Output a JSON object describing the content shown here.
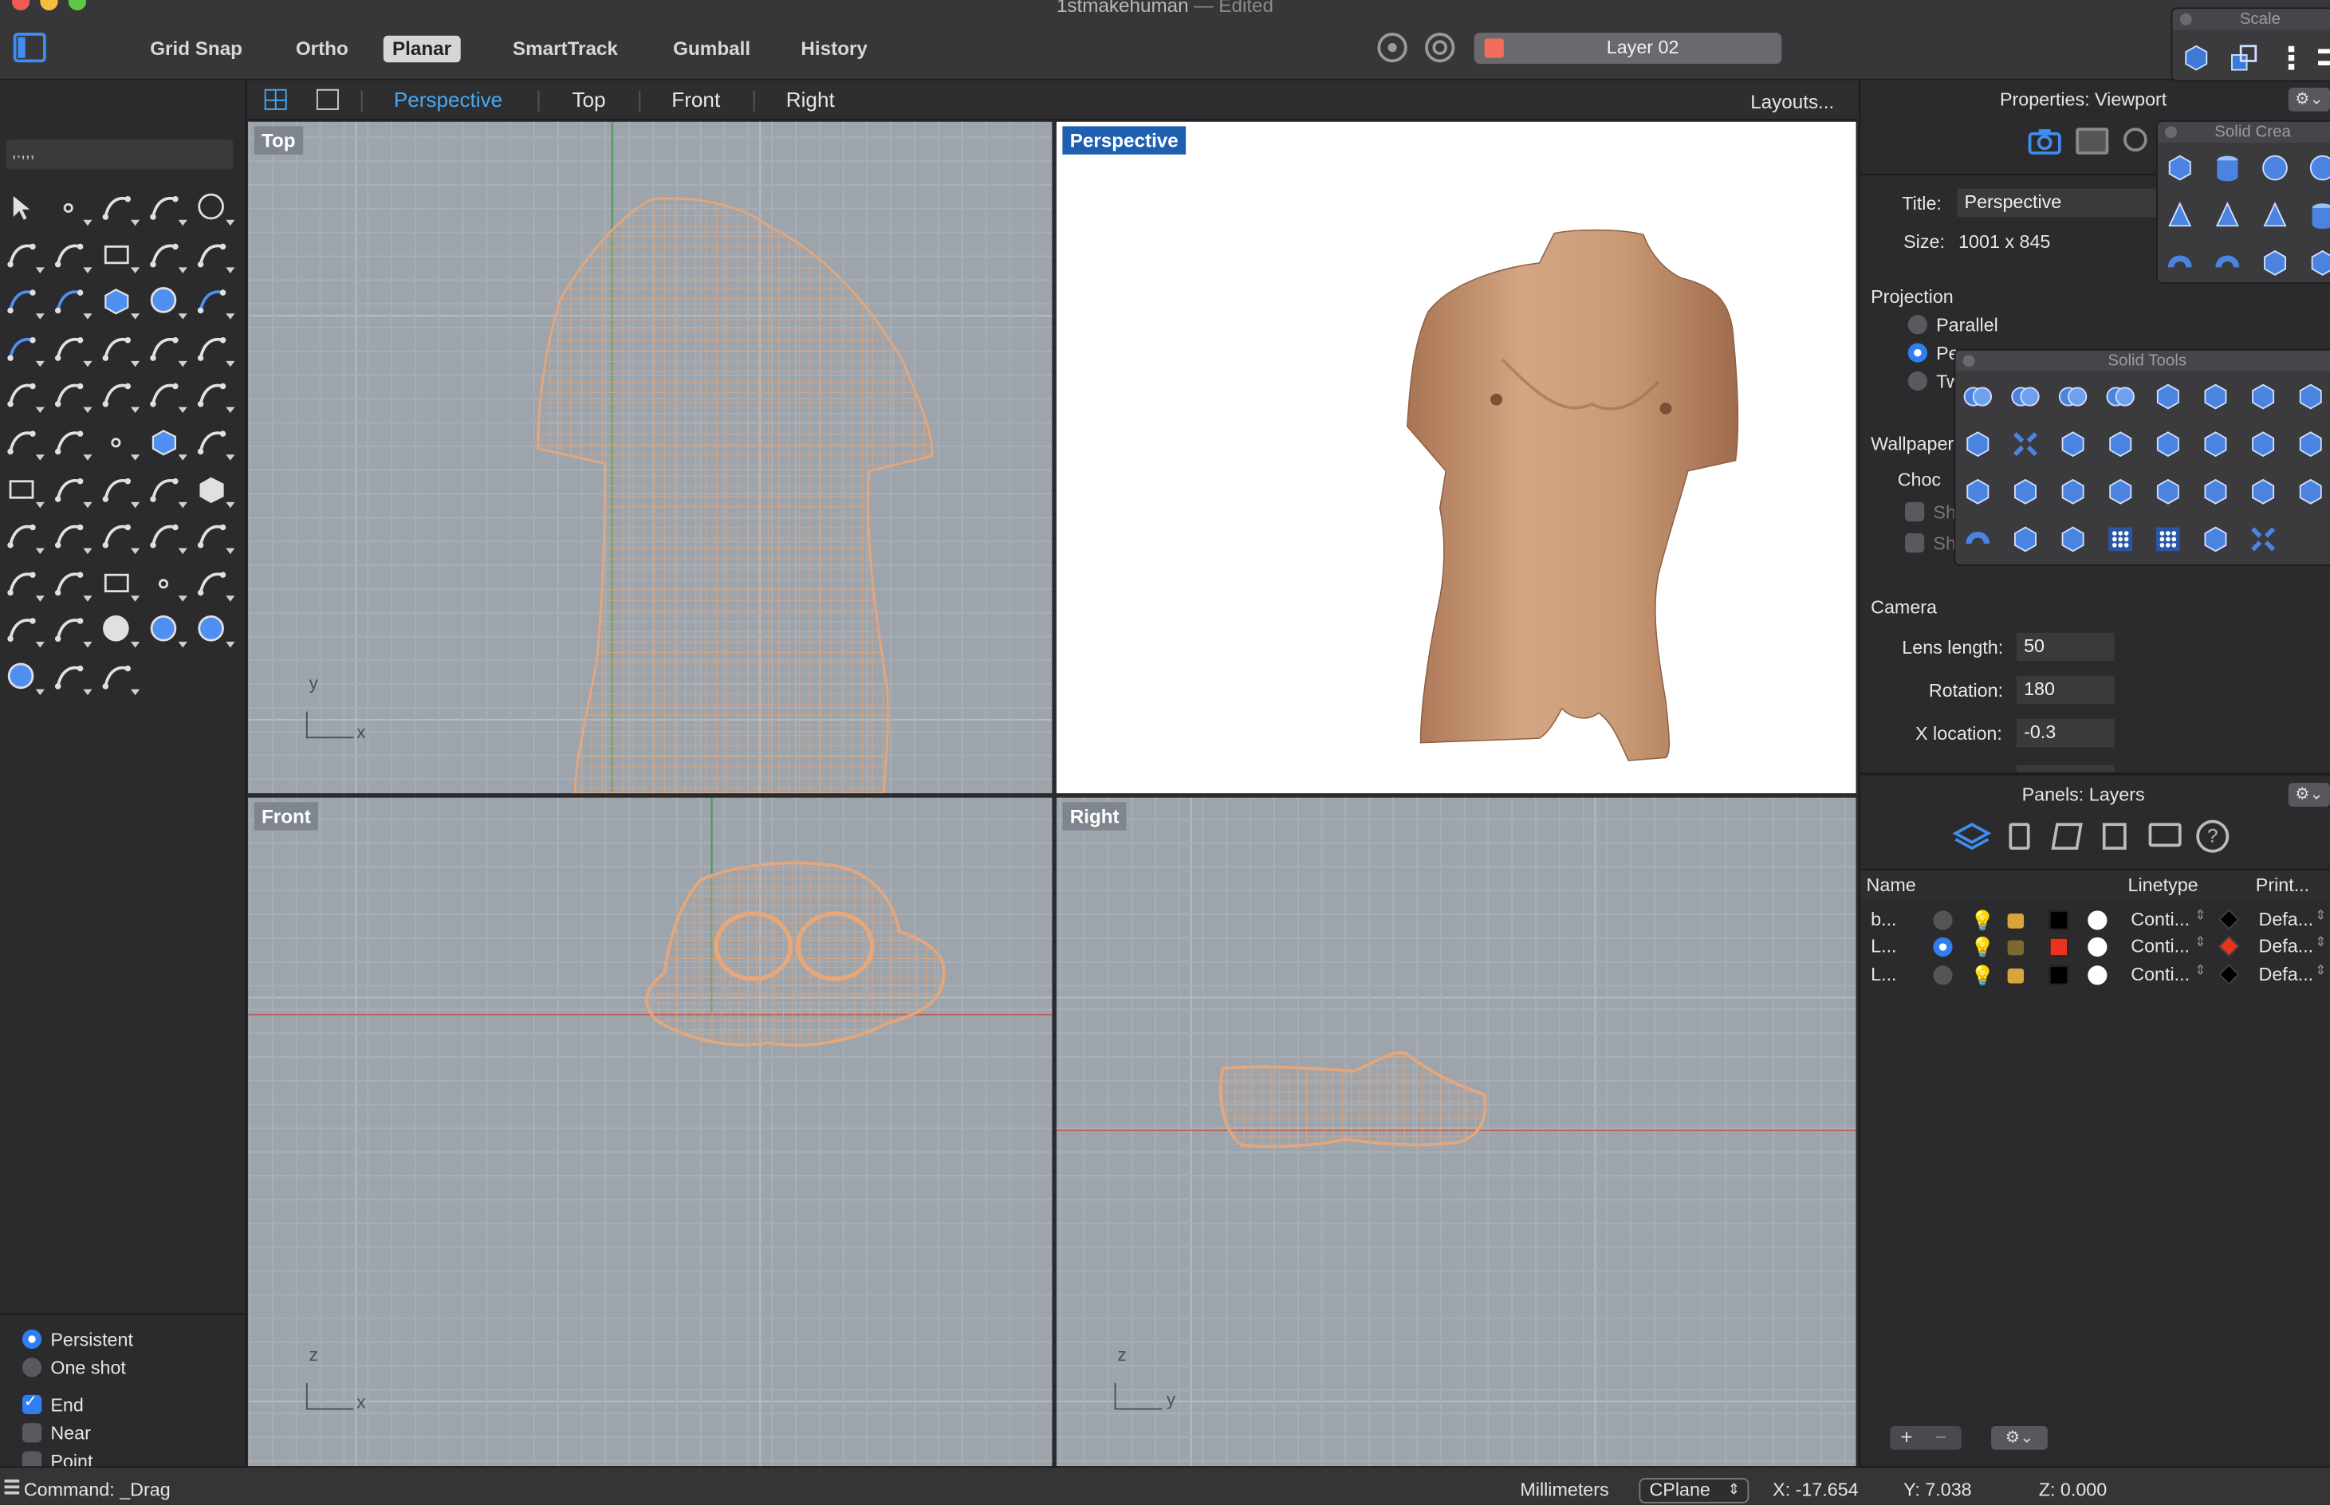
{
  "window": {
    "title": "1stmakehuman",
    "edited_suffix": "— Edited"
  },
  "toolbar": {
    "modes": [
      {
        "label": "Grid Snap",
        "active": false
      },
      {
        "label": "Ortho",
        "active": false
      },
      {
        "label": "Planar",
        "active": true
      },
      {
        "label": "SmartTrack",
        "active": false
      },
      {
        "label": "Gumball",
        "active": false
      },
      {
        "label": "History",
        "active": false
      }
    ],
    "current_layer": {
      "name": "Layer 02",
      "color": "#f26d5b"
    }
  },
  "command_input": {
    "value": ",.,,,"
  },
  "viewport_tabs": {
    "items": [
      "Perspective",
      "Top",
      "Front",
      "Right"
    ],
    "active": "Perspective",
    "layouts_label": "Layouts..."
  },
  "viewports": {
    "top": {
      "label": "Top",
      "axis_v": "y",
      "axis_h": "x"
    },
    "perspective": {
      "label": "Perspective"
    },
    "front": {
      "label": "Front",
      "axis_v": "z",
      "axis_h": "x"
    },
    "right": {
      "label": "Right",
      "axis_v": "z",
      "axis_h": "y"
    }
  },
  "osnap": {
    "persistent_label": "Persistent",
    "oneshot_label": "One shot",
    "end_label": "End",
    "near_label": "Near",
    "point_label": "Point",
    "end_checked": true,
    "near_checked": false
  },
  "properties_panel": {
    "title": "Properties: Viewport",
    "title_label": "Title:",
    "title_value": "Perspective",
    "size_label": "Size:",
    "size_value": "1001 x 845",
    "projection_label": "Projection",
    "parallel_label": "Parallel",
    "perspective_label_partial": "Pe",
    "twopoint_label_partial": "Tw",
    "wallpaper_label": "Wallpaper",
    "choose_label_partial": "Choc",
    "show_label_partial": "Sho",
    "camera_label": "Camera",
    "lens_label": "Lens length:",
    "lens_value": "50",
    "rotation_label": "Rotation:",
    "rotation_value": "180",
    "xloc_label": "X location:",
    "xloc_value": "-0.3"
  },
  "layers_panel": {
    "title": "Panels: Layers",
    "col_name": "Name",
    "col_linetype": "Linetype",
    "col_print": "Print...",
    "rows": [
      {
        "name": "b...",
        "current": false,
        "color": "#000000",
        "linetype": "Conti...",
        "print": "Defa...",
        "print_color": "#000000"
      },
      {
        "name": "L...",
        "current": true,
        "color": "#e8331f",
        "linetype": "Conti...",
        "print": "Defa...",
        "print_color": "#e8331f"
      },
      {
        "name": "L...",
        "current": false,
        "color": "#000000",
        "linetype": "Conti...",
        "print": "Defa...",
        "print_color": "#000000"
      }
    ]
  },
  "palettes": {
    "scale_title": "Scale",
    "solid_creation_title": "Solid Crea",
    "solid_tools_title": "Solid Tools"
  },
  "statusbar": {
    "command": "Command: _Drag",
    "units": "Millimeters",
    "cplane": "CPlane",
    "x": "X: -17.654",
    "y": "Y: 7.038",
    "z": "Z: 0.000"
  },
  "colors": {
    "accent": "#2f7ff2",
    "mesh": "#e8a77a",
    "skin": "#c99a76"
  }
}
